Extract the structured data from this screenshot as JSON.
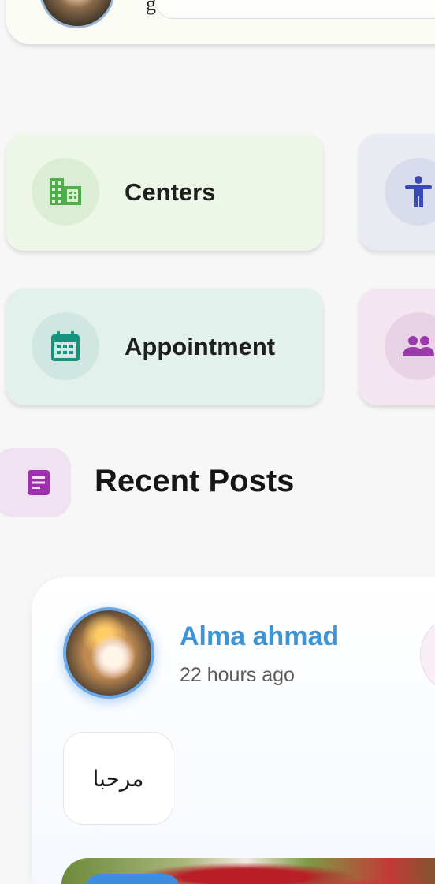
{
  "header": {
    "partial_text": "g"
  },
  "categories": [
    {
      "label": "Centers",
      "icon": "building-icon",
      "bg": "#eef6e8",
      "icon_bg": "#dbeed3",
      "icon_color": "#4fae4b"
    },
    {
      "label": "",
      "icon": "accessibility-icon",
      "bg": "#e9ebf2",
      "icon_bg": "#d9dcec",
      "icon_color": "#3a4ab3"
    },
    {
      "label": "Appointment",
      "icon": "calendar-icon",
      "bg": "#e3f1ed",
      "icon_bg": "#cfe7e0",
      "icon_color": "#16937f"
    },
    {
      "label": "",
      "icon": "group-icon",
      "bg": "#f3e6f1",
      "icon_bg": "#ead2e6",
      "icon_color": "#9b3aab"
    }
  ],
  "recent_posts": {
    "title": "Recent Posts",
    "icon": "article-icon",
    "icon_color": "#9f2fb0"
  },
  "post": {
    "author": "Alma ahmad",
    "time": "22 hours ago",
    "text": "مرحبا"
  },
  "colors": {
    "accent_blue": "#3d94d6",
    "background": "#f7f7f8"
  }
}
